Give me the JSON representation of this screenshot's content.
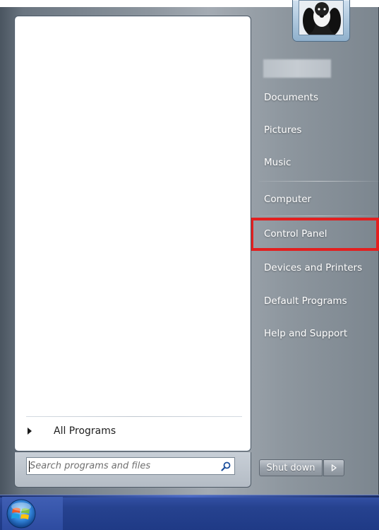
{
  "left_pane": {
    "all_programs_label": "All Programs"
  },
  "search": {
    "placeholder": "Search programs and files",
    "value": ""
  },
  "right_pane": {
    "items": [
      {
        "label": "Documents"
      },
      {
        "label": "Pictures"
      },
      {
        "label": "Music"
      },
      {
        "label": "Computer"
      },
      {
        "label": "Control Panel"
      },
      {
        "label": "Devices and Printers"
      },
      {
        "label": "Default Programs"
      },
      {
        "label": "Help and Support"
      }
    ],
    "highlighted_item": "Control Panel"
  },
  "shutdown": {
    "label": "Shut down"
  },
  "colors": {
    "highlight": "#e31f1f",
    "taskbar": "#26428f",
    "glass": "#8d969f"
  },
  "icons": [
    "play-arrow-icon",
    "search-icon",
    "user-picture-dog",
    "chevron-right-icon",
    "windows-start-orb"
  ]
}
